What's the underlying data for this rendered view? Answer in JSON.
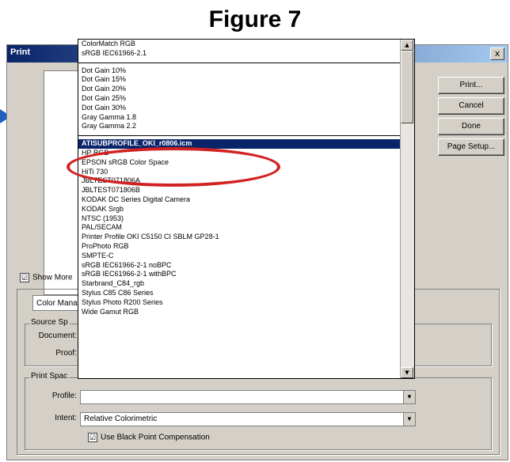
{
  "figure_title": "Figure 7",
  "dialog": {
    "title": "Print",
    "close_symbol": "x"
  },
  "buttons": {
    "print": "Print...",
    "cancel": "Cancel",
    "done": "Done",
    "page_setup": "Page Setup..."
  },
  "options": {
    "show_more_checked": "☑",
    "show_more": "Show More",
    "color_mgmt_select": "Color Mana"
  },
  "source_space": {
    "label": "Source Sp",
    "document_label": "Document:",
    "proof_label": "Proof:"
  },
  "print_space": {
    "label": "Print Spac",
    "profile_label": "Profile:",
    "profile_value": "",
    "intent_label": "Intent:",
    "intent_value": "Relative Colorimetric",
    "bpc_checked": "☑",
    "bpc_label": "Use Black Point Compensation"
  },
  "dropdown": {
    "items": [
      "ColorMatch RGB",
      "sRGB IEC61966-2.1",
      "",
      "Dot Gain 10%",
      "Dot Gain 15%",
      "Dot Gain 20%",
      "Dot Gain 25%",
      "Dot Gain 30%",
      "Gray Gamma 1.8",
      "Gray Gamma 2.2",
      "",
      "ATISUBPROFILE_OKI_r0806.icm",
      "HP RGB",
      "EPSON  sRGB Color Space",
      "HiTi 730",
      "JBLTEST071806A",
      "JBLTEST071806B",
      "KODAK DC Series Digital Camera",
      "KODAK Srgb",
      "NTSC (1953)",
      "PAL/SECAM",
      "Printer Profile OKI C5150 CI SBLM GP28-1",
      "ProPhoto RGB",
      "SMPTE-C",
      "sRGB IEC61966-2-1 noBPC",
      "sRGB IEC61966-2-1 withBPC",
      "Starbrand_C84_rgb",
      "Stylus C85 C86 Series",
      "Stylus Photo R200 Series",
      "Wide Gamut RGB"
    ],
    "selected_index": 11
  },
  "scroll_symbols": {
    "up": "▲",
    "down": "▼"
  },
  "colors": {
    "highlight_ellipse": "#d22222",
    "selection": "#0a246a",
    "arrow": "#1f5fbf"
  }
}
